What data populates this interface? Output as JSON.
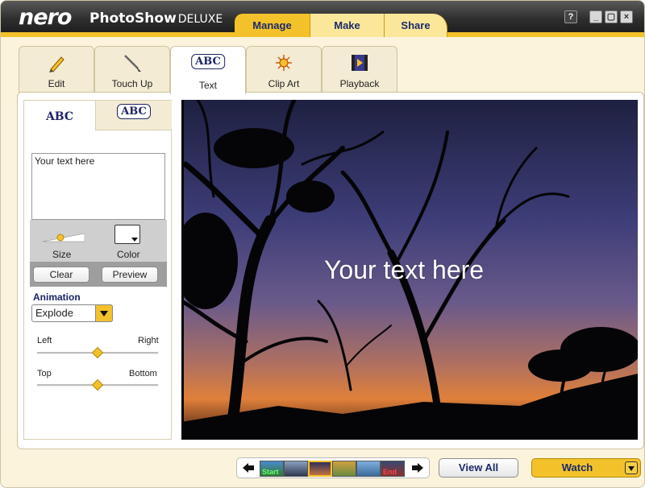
{
  "app": {
    "logo": "nero",
    "product": "PhotoShow",
    "edition": "DELUXE"
  },
  "main_tabs": [
    {
      "label": "Manage",
      "active": true
    },
    {
      "label": "Make",
      "active": false
    },
    {
      "label": "Share",
      "active": false
    }
  ],
  "window_buttons": {
    "help": "?",
    "minimize": "_",
    "restore": "▢",
    "close": "×"
  },
  "tool_tabs": [
    {
      "label": "Edit",
      "icon": "pencil-icon"
    },
    {
      "label": "Touch Up",
      "icon": "brush-icon"
    },
    {
      "label": "Text",
      "icon": "abc-speech-bubble-icon",
      "active": true,
      "icon_text": "ABC"
    },
    {
      "label": "Clip Art",
      "icon": "star-burst-icon"
    },
    {
      "label": "Playback",
      "icon": "film-play-icon"
    }
  ],
  "text_panel": {
    "subtab_plain": "ABC",
    "subtab_bubble": "ABC",
    "text_value": "Your text here",
    "size_label": "Size",
    "color_label": "Color",
    "clear_label": "Clear",
    "preview_label": "Preview",
    "animation_label": "Animation",
    "animation_value": "Explode",
    "horizontal": {
      "left_label": "Left",
      "right_label": "Right",
      "value": 0.5
    },
    "vertical": {
      "top_label": "Top",
      "bottom_label": "Bottom",
      "value": 0.5
    }
  },
  "photo": {
    "overlay_text": "Your text here"
  },
  "filmstrip": {
    "start_label": "Start",
    "end_label": "End"
  },
  "footer": {
    "view_all_label": "View All",
    "watch_label": "Watch"
  },
  "colors": {
    "accent": "#f3c12a",
    "navy": "#1b2a6a"
  }
}
